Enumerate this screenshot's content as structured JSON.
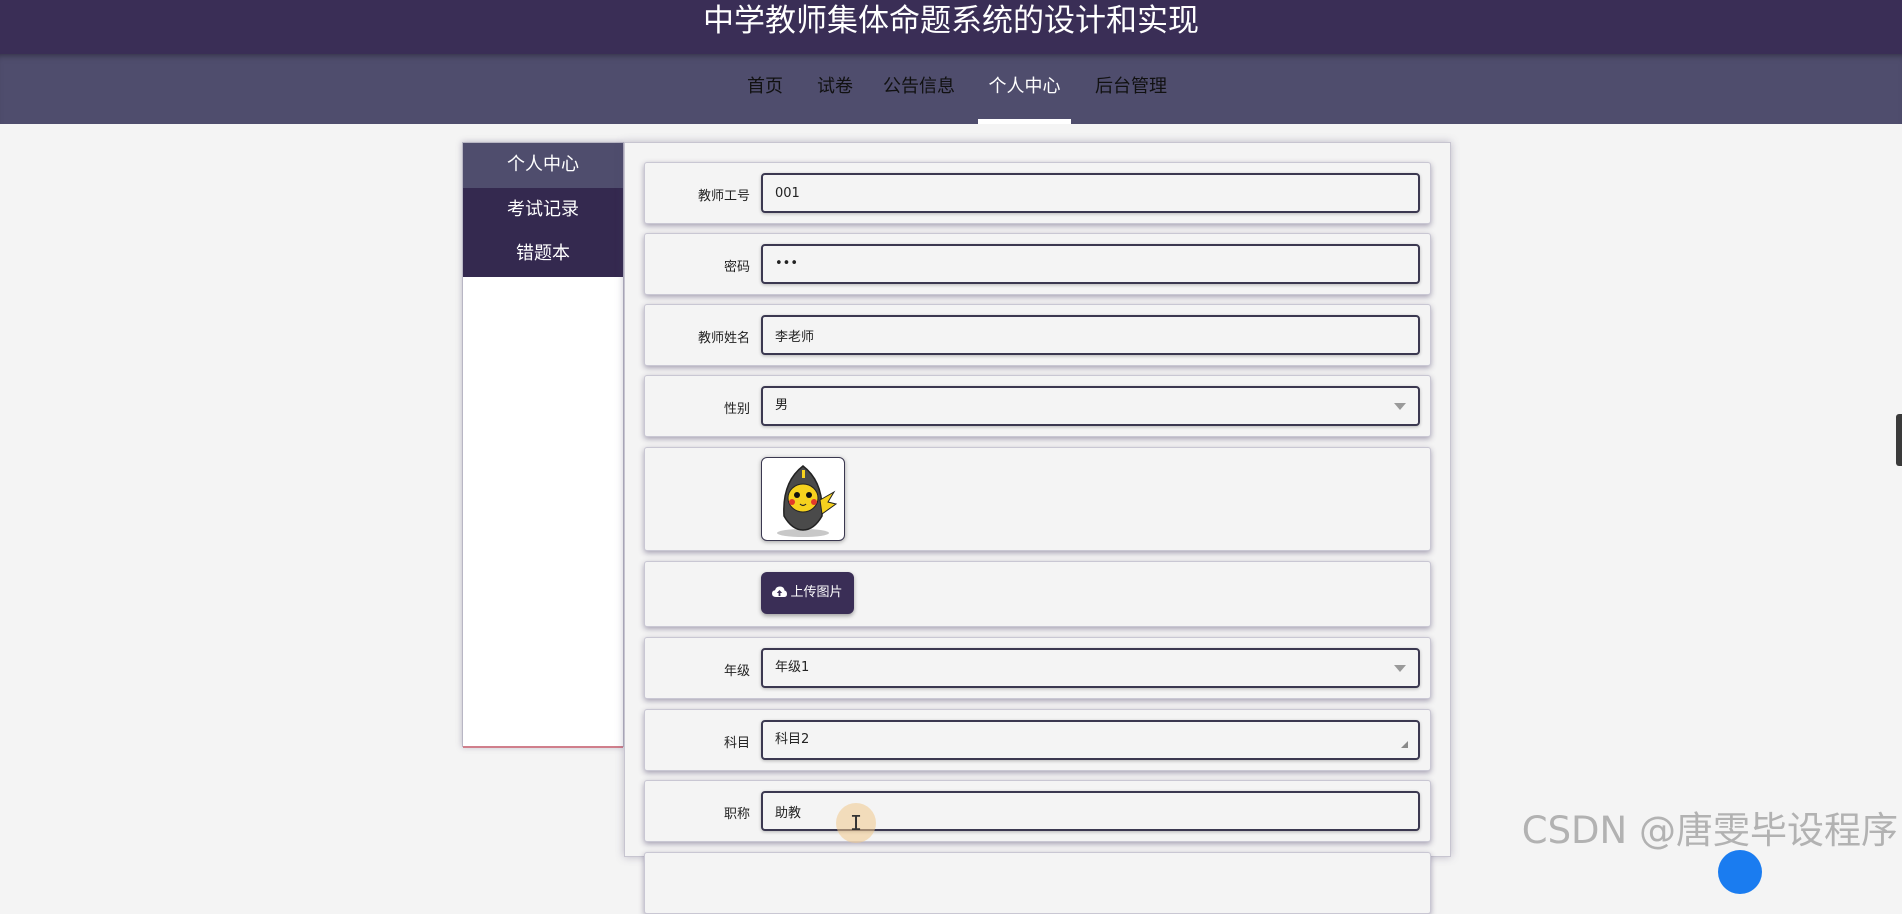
{
  "header": {
    "title": "中学教师集体命题系统的设计和实现"
  },
  "nav": {
    "items": [
      {
        "label": "首页",
        "active": false
      },
      {
        "label": "试卷",
        "active": false
      },
      {
        "label": "公告信息",
        "active": false
      },
      {
        "label": "个人中心",
        "active": true
      },
      {
        "label": "后台管理",
        "active": false
      }
    ]
  },
  "sidebar": {
    "items": [
      {
        "label": "个人中心",
        "active": true
      },
      {
        "label": "考试记录",
        "active": false
      },
      {
        "label": "错题本",
        "active": false
      }
    ]
  },
  "form": {
    "teacher_id": {
      "label": "教师工号",
      "value": "001"
    },
    "password": {
      "label": "密码",
      "value": "•••"
    },
    "teacher_name": {
      "label": "教师姓名",
      "value": "李老师"
    },
    "gender": {
      "label": "性别",
      "value": "男"
    },
    "upload": {
      "label": "上传图片",
      "icon": "cloud-upload-icon"
    },
    "grade": {
      "label": "年级",
      "value": "年级1"
    },
    "subject": {
      "label": "科目",
      "value": "科目2"
    },
    "title": {
      "label": "职称",
      "value": "助教"
    }
  },
  "watermark": "CSDN @唐雯毕设程序",
  "colors": {
    "header_bg": "#3a2e56",
    "nav_bg": "#4f4d6d",
    "sidebar_bg": "#34294f",
    "field_border": "#3b3850"
  }
}
